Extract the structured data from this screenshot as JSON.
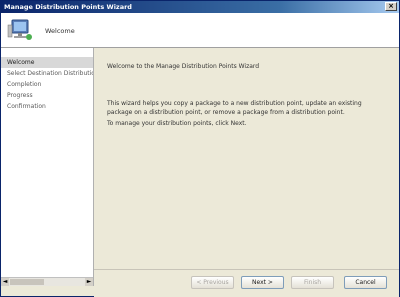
{
  "window": {
    "title": "Manage Distribution Points Wizard",
    "close_glyph": "×"
  },
  "header": {
    "title": "Welcome",
    "icon": "computer-monitor-icon"
  },
  "sidebar": {
    "items": [
      {
        "label": "Welcome",
        "active": true
      },
      {
        "label": "Select Destination Distribution Points",
        "active": false
      },
      {
        "label": "Completion",
        "active": false
      },
      {
        "label": "Progress",
        "active": false
      },
      {
        "label": "Confirmation",
        "active": false
      }
    ],
    "scroll_left_glyph": "◄",
    "scroll_right_glyph": "►"
  },
  "content": {
    "heading": "Welcome to the Manage Distribution Points Wizard",
    "description": "This wizard helps you copy a package to a new distribution point, update an existing package on a distribution point, or remove a package from a distribution point.",
    "instruction": "To manage your distribution points, click Next."
  },
  "footer": {
    "previous": "< Previous",
    "next": "Next >",
    "finish": "Finish",
    "cancel": "Cancel"
  }
}
